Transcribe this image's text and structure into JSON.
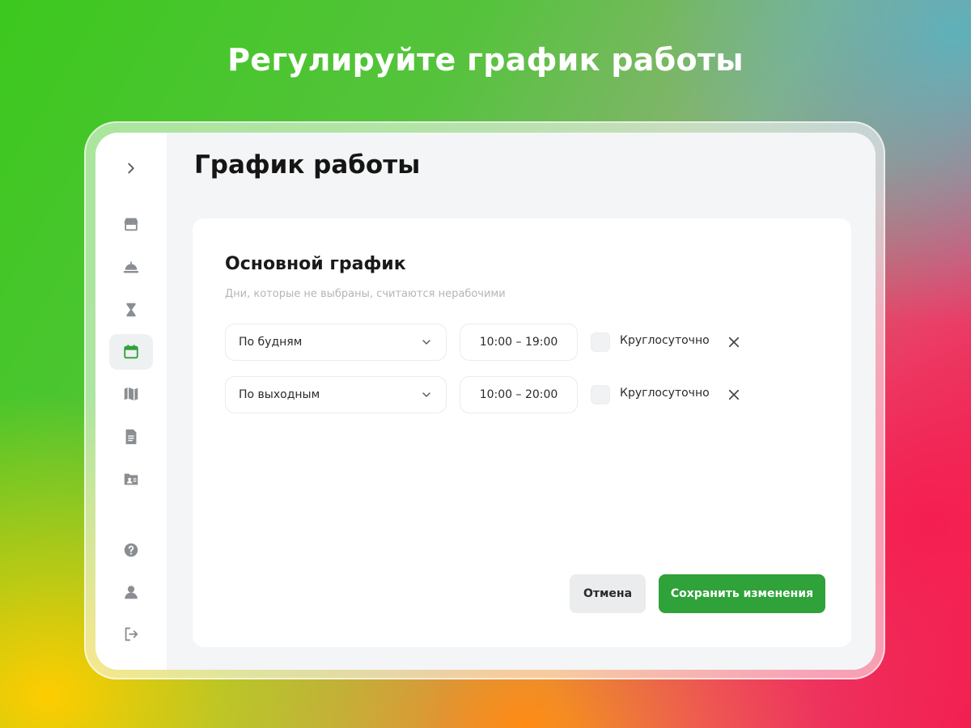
{
  "headline": "Регулируйте график работы",
  "page": {
    "title": "График работы"
  },
  "sidebar": {
    "items": [
      {
        "icon": "chevron-right-icon"
      },
      {
        "icon": "store-icon"
      },
      {
        "icon": "service-bell-icon"
      },
      {
        "icon": "hourglass-icon"
      },
      {
        "icon": "calendar-icon",
        "active": true
      },
      {
        "icon": "map-icon"
      },
      {
        "icon": "document-icon"
      },
      {
        "icon": "folder-user-icon"
      },
      {
        "icon": "help-icon"
      },
      {
        "icon": "profile-icon"
      },
      {
        "icon": "logout-icon"
      }
    ],
    "active_color": "#2fa23a",
    "icon_color": "#8a8e92"
  },
  "schedule": {
    "title": "Основной график",
    "subtitle": "Дни, которые не выбраны, считаются нерабочими",
    "rows": [
      {
        "days": "По будням",
        "time": "10:00 – 19:00",
        "around_clock_label": "Круглосуточно",
        "around_clock": false
      },
      {
        "days": "По выходным",
        "time": "10:00 – 20:00",
        "around_clock_label": "Круглосуточно",
        "around_clock": false
      }
    ]
  },
  "actions": {
    "cancel_label": "Отмена",
    "save_label": "Сохранить изменения",
    "save_color": "#2fa23a"
  }
}
